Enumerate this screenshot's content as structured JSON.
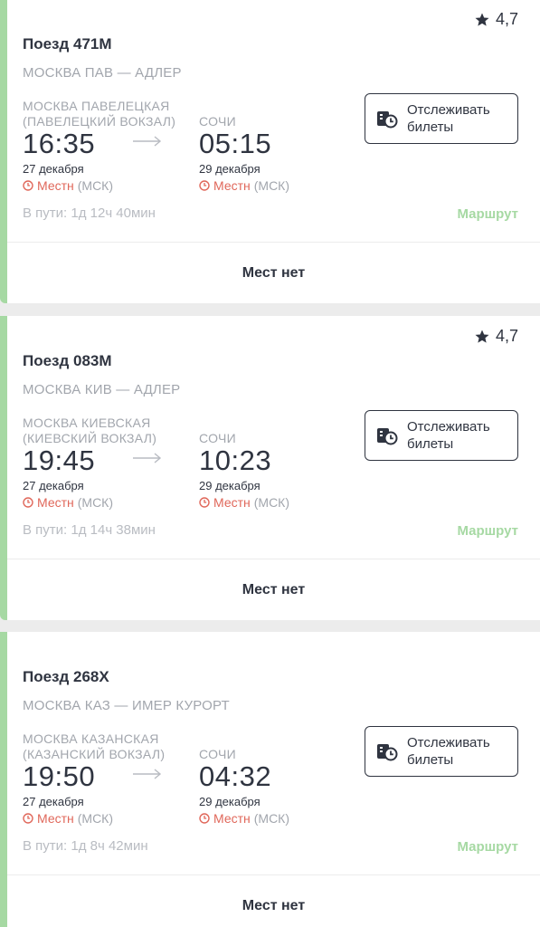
{
  "trains": [
    {
      "rating": "4,7",
      "title": "Поезд 471М",
      "route": "МОСКВА ПАВ — АДЛЕР",
      "dep_station_1": "МОСКВА ПАВЕЛЕЦКАЯ",
      "dep_station_2": "(ПАВЕЛЕЦКИЙ ВОКЗАЛ)",
      "arr_station": "СОЧИ",
      "dep_time": "16:35",
      "arr_time": "05:15",
      "dep_date": "27 декабря",
      "arr_date": "29 декабря",
      "tz_local": "Местн",
      "tz_msk": "(МСК)",
      "duration": "В пути: 1д 12ч 40мин",
      "route_link": "Маршрут",
      "track_label": "Отслеживать\nбилеты",
      "seats": "Мест нет"
    },
    {
      "rating": "4,7",
      "title": "Поезд 083М",
      "route": "МОСКВА КИВ — АДЛЕР",
      "dep_station_1": "МОСКВА КИЕВСКАЯ",
      "dep_station_2": "(КИЕВСКИЙ ВОКЗАЛ)",
      "arr_station": "СОЧИ",
      "dep_time": "19:45",
      "arr_time": "10:23",
      "dep_date": "27 декабря",
      "arr_date": "29 декабря",
      "tz_local": "Местн",
      "tz_msk": "(МСК)",
      "duration": "В пути: 1д 14ч 38мин",
      "route_link": "Маршрут",
      "track_label": "Отслеживать\nбилеты",
      "seats": "Мест нет"
    },
    {
      "rating": "",
      "title": "Поезд 268Х",
      "route": "МОСКВА КАЗ — ИМЕР КУРОРТ",
      "dep_station_1": "МОСКВА КАЗАНСКАЯ",
      "dep_station_2": "(КАЗАНСКИЙ ВОКЗАЛ)",
      "arr_station": "СОЧИ",
      "dep_time": "19:50",
      "arr_time": "04:32",
      "dep_date": "27 декабря",
      "arr_date": "29 декабря",
      "tz_local": "Местн",
      "tz_msk": "(МСК)",
      "duration": "В пути: 1д 8ч 42мин",
      "route_link": "Маршрут",
      "track_label": "Отслеживать\nбилеты",
      "seats": "Мест нет"
    }
  ],
  "colors": {
    "accent_green": "#a6d9a3",
    "local_time_red": "#e0675a",
    "text_dark": "#2f3440",
    "text_muted": "#a2a6ad"
  },
  "icons": [
    "star-icon",
    "ticket-clock-icon",
    "clock-icon",
    "arrow-right-icon"
  ]
}
